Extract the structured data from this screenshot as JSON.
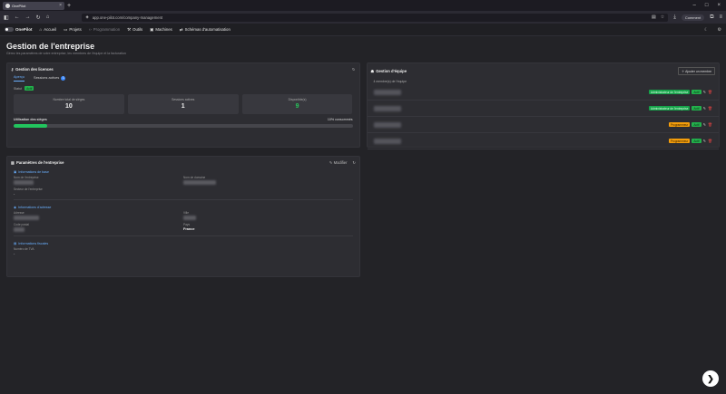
{
  "browser": {
    "tab_title": "OnePilot",
    "url": "app.one-pilot.com/company-management",
    "comment_label": "Comment"
  },
  "appnav": {
    "brand": "OnePilot",
    "items": [
      {
        "label": "Accueil",
        "icon": "home-icon"
      },
      {
        "label": "Projets",
        "icon": "folder-icon"
      },
      {
        "label": "Programmation",
        "icon": "code-icon"
      },
      {
        "label": "Outils",
        "icon": "wrench-icon"
      },
      {
        "label": "Machines",
        "icon": "machine-icon"
      },
      {
        "label": "Schémas d'automatisation",
        "icon": "flow-icon"
      }
    ]
  },
  "page": {
    "title": "Gestion de l'entreprise",
    "subtitle": "Gérez les paramètres de votre entreprise, les membres de l'équipe et la facturation"
  },
  "licenses": {
    "title": "Gestion des licences",
    "tabs": [
      {
        "label": "Aperçu"
      },
      {
        "label": "Sessions actives",
        "count": "1"
      }
    ],
    "status_label": "Statut",
    "status_value": "Actif",
    "stats": [
      {
        "label": "Nombre total de sièges",
        "value": "10"
      },
      {
        "label": "Sessions actives",
        "value": "1"
      },
      {
        "label": "Disponible(s)",
        "value": "9"
      }
    ],
    "usage_label": "Utilisation des sièges",
    "usage_value": "10% consommés",
    "usage_fraction": 0.1
  },
  "team": {
    "title": "Gestion d'équipe",
    "add_label": "Ajouter un membre",
    "meta": "4 membre(s) de l'équipe",
    "members": [
      {
        "role": "Administrateur de l'entreprise",
        "role_color": "green",
        "status": "Actif"
      },
      {
        "role": "Administrateur de l'entreprise",
        "role_color": "green",
        "status": "Actif"
      },
      {
        "role": "Programmeur",
        "role_color": "orange",
        "status": "Actif"
      },
      {
        "role": "Programmeur",
        "role_color": "orange",
        "status": "Actif"
      }
    ]
  },
  "company": {
    "title": "Paramètres de l'entreprise",
    "edit_label": "Modifier",
    "sections": {
      "company_info": "Informations de base",
      "contact": "Informations d'adresse",
      "billing": "Informations fiscales"
    },
    "fields": {
      "name_label": "Nom de l'entreprise",
      "domain_label": "Nom de domaine",
      "industry_label": "Secteur de l'entreprise",
      "industry_value": "-",
      "address_label": "Adresse",
      "city_label": "Ville",
      "postal_label": "Code postal",
      "country_label": "Pays",
      "country_value": "France",
      "vat_label": "Numéro de TVA",
      "vat_value": "-"
    }
  }
}
